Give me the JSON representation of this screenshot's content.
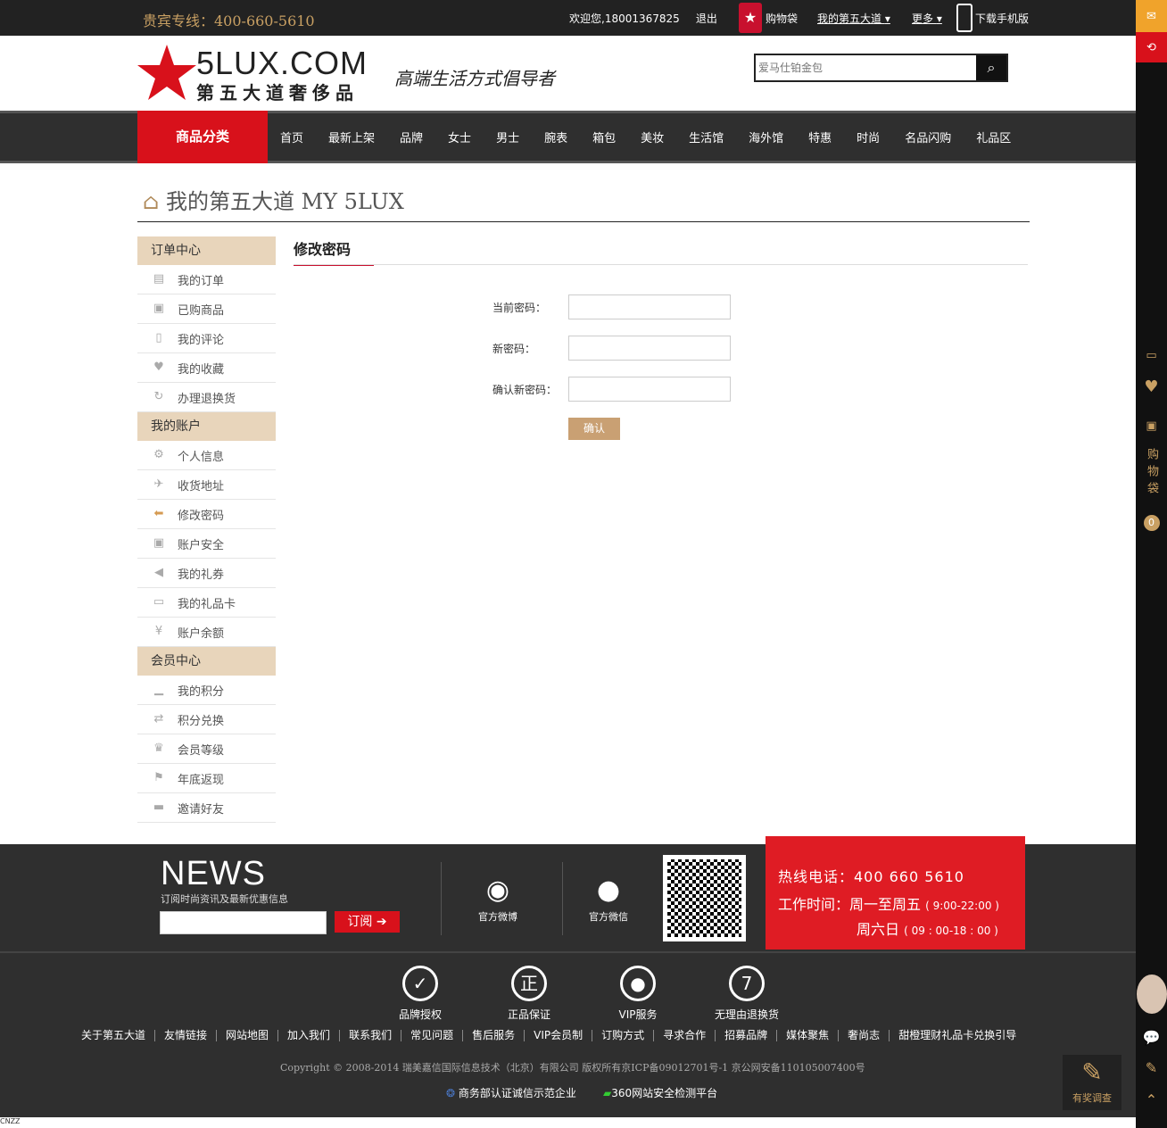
{
  "topbar": {
    "vip_line": "贵宾专线：400-660-5610",
    "welcome": "欢迎您,18001367825",
    "logout": "退出",
    "cart": "购物袋",
    "my5lux": "我的第五大道",
    "more": "更多",
    "download": "下载手机版"
  },
  "logo": {
    "brand": "5LUX.COM",
    "cn_name": "第五大道奢侈品",
    "slogan": "高端生活方式倡导者"
  },
  "search": {
    "placeholder": "爱马仕铂金包"
  },
  "nav": {
    "category": "商品分类",
    "items": [
      "首页",
      "最新上架",
      "品牌",
      "女士",
      "男士",
      "腕表",
      "箱包",
      "美妆",
      "生活馆",
      "海外馆",
      "特惠",
      "时尚",
      "名品闪购",
      "礼品区"
    ]
  },
  "page": {
    "title": "我的第五大道 MY 5LUX"
  },
  "menu": {
    "orders_head": "订单中心",
    "orders": [
      {
        "label": "我的订单",
        "icon": "clipboard-icon"
      },
      {
        "label": "已购商品",
        "icon": "bag-icon"
      },
      {
        "label": "我的评论",
        "icon": "phone-icon"
      },
      {
        "label": "我的收藏",
        "icon": "heart-icon"
      },
      {
        "label": "办理退换货",
        "icon": "refresh-icon"
      }
    ],
    "account_head": "我的账户",
    "account": [
      {
        "label": "个人信息",
        "icon": "gear-icon"
      },
      {
        "label": "收货地址",
        "icon": "plane-icon"
      },
      {
        "label": "修改密码",
        "icon": "key-icon"
      },
      {
        "label": "账户安全",
        "icon": "lock-icon"
      },
      {
        "label": "我的礼券",
        "icon": "tag-icon"
      },
      {
        "label": "我的礼品卡",
        "icon": "card-icon"
      },
      {
        "label": "账户余额",
        "icon": "yen-icon"
      }
    ],
    "member_head": "会员中心",
    "member": [
      {
        "label": "我的积分",
        "icon": "chart-icon"
      },
      {
        "label": "积分兑换",
        "icon": "exchange-icon"
      },
      {
        "label": "会员等级",
        "icon": "crown-icon"
      },
      {
        "label": "年底返现",
        "icon": "flag-icon"
      },
      {
        "label": "邀请好友",
        "icon": "chat-icon"
      }
    ]
  },
  "form": {
    "title": "修改密码",
    "current_label": "当前密码：",
    "new_label": "新密码：",
    "confirm_label": "确认新密码：",
    "submit": "确认"
  },
  "footer": {
    "news": "NEWS",
    "news_sub": "订阅时尚资讯及最新优惠信息",
    "subscribe": "订阅",
    "weibo": "官方微博",
    "weixin": "官方微信",
    "hotline": "热线电话：400 660 5610",
    "hours_label": "工作时间：周一至周五",
    "hours_weekday": "( 9:00-22:00 )",
    "hours_sat_label": "周六日",
    "hours_sat": "( 09 : 00-18 : 00 )",
    "badges": [
      "品牌授权",
      "正品保证",
      "VIP服务",
      "无理由退换货"
    ],
    "links": [
      "关于第五大道",
      "友情链接",
      "网站地图",
      "加入我们",
      "联系我们",
      "常见问题",
      "售后服务",
      "VIP会员制",
      "订购方式",
      "寻求合作",
      "招募品牌",
      "媒体聚焦",
      "奢尚志",
      "甜橙理财礼品卡兑换引导"
    ],
    "copyright": "Copyright © 2008-2014 瑞美嘉信国际信息技术（北京）有限公司   版权所有京ICP备09012701号-1   京公网安备110105007400号",
    "trust1": "商务部认证诚信示范企业",
    "trust2": "360网站安全检测平台",
    "survey": "有奖调查"
  },
  "sidebar": {
    "cart_label": "购物袋",
    "cart_count": "0"
  },
  "colors": {
    "accent": "#d8111b",
    "gold": "#c9a063",
    "menu_head": "#e8d5bb"
  }
}
